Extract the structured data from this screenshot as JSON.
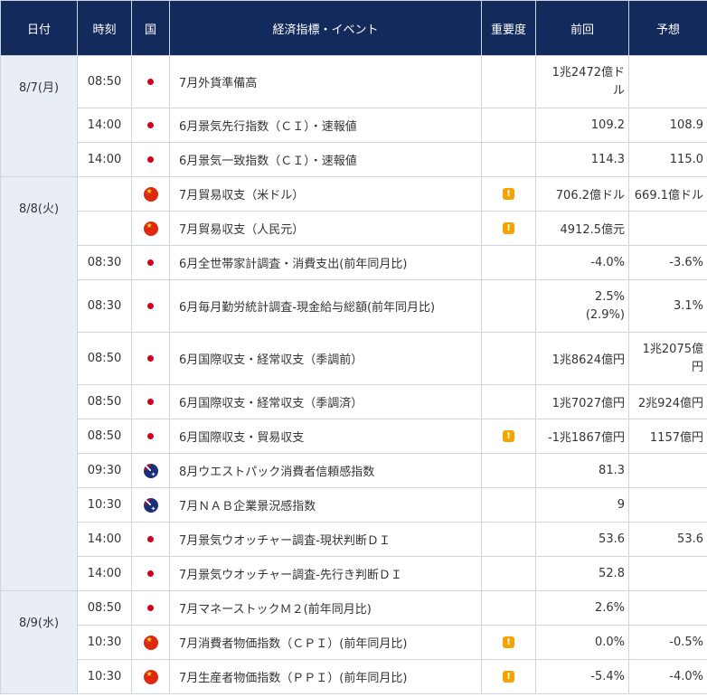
{
  "header": {
    "date": "日付",
    "time": "時刻",
    "country": "国",
    "indicator": "経済指標・イベント",
    "importance": "重要度",
    "previous": "前回",
    "forecast": "予想"
  },
  "colors": {
    "header_bg": "#132a5c",
    "date_bg": "#e9eef6",
    "importance": "#f5a300"
  },
  "icons": {
    "japan": "japan-flag-icon",
    "china": "china-flag-icon",
    "australia": "australia-flag-icon",
    "importance": "exclamation-icon"
  },
  "days": [
    {
      "date": "8/7(月)"
    },
    {
      "date": "8/8(火)"
    },
    {
      "date": "8/9(水)"
    }
  ],
  "rows": [
    {
      "time": "08:50",
      "country": "japan",
      "indicator": "7月外貨準備高",
      "important": false,
      "previous": [
        "1兆2472億ド",
        "ル"
      ],
      "forecast": [
        ""
      ]
    },
    {
      "time": "14:00",
      "country": "japan",
      "indicator": "6月景気先行指数（ＣＩ）・速報値",
      "important": false,
      "previous": [
        "109.2"
      ],
      "forecast": [
        "108.9"
      ]
    },
    {
      "time": "14:00",
      "country": "japan",
      "indicator": "6月景気一致指数（ＣＩ）・速報値",
      "important": false,
      "previous": [
        "114.3"
      ],
      "forecast": [
        "115.0"
      ]
    },
    {
      "time": "",
      "country": "china",
      "indicator": "7月貿易収支（米ドル）",
      "important": true,
      "previous": [
        "706.2億ドル"
      ],
      "forecast": [
        "669.1億ドル"
      ]
    },
    {
      "time": "",
      "country": "china",
      "indicator": "7月貿易収支（人民元）",
      "important": true,
      "previous": [
        "4912.5億元"
      ],
      "forecast": [
        ""
      ]
    },
    {
      "time": "08:30",
      "country": "japan",
      "indicator": "6月全世帯家計調査・消費支出(前年同月比)",
      "important": false,
      "previous": [
        "-4.0%"
      ],
      "forecast": [
        "-3.6%"
      ]
    },
    {
      "time": "08:30",
      "country": "japan",
      "indicator": "6月毎月勤労統計調査-現金給与総額(前年同月比)",
      "important": false,
      "previous": [
        "2.5%",
        "(2.9%)"
      ],
      "forecast": [
        "3.1%"
      ]
    },
    {
      "time": "08:50",
      "country": "japan",
      "indicator": "6月国際収支・経常収支（季調前）",
      "important": false,
      "previous": [
        "1兆8624億円"
      ],
      "forecast": [
        "1兆2075億",
        "円"
      ]
    },
    {
      "time": "08:50",
      "country": "japan",
      "indicator": "6月国際収支・経常収支（季調済）",
      "important": false,
      "previous": [
        "1兆7027億円"
      ],
      "forecast": [
        "2兆924億円"
      ]
    },
    {
      "time": "08:50",
      "country": "japan",
      "indicator": "6月国際収支・貿易収支",
      "important": true,
      "previous": [
        "-1兆1867億円"
      ],
      "forecast": [
        "1157億円"
      ]
    },
    {
      "time": "09:30",
      "country": "australia",
      "indicator": "8月ウエストパック消費者信頼感指数",
      "important": false,
      "previous": [
        "81.3"
      ],
      "forecast": [
        ""
      ]
    },
    {
      "time": "10:30",
      "country": "australia",
      "indicator": "7月ＮＡＢ企業景況感指数",
      "important": false,
      "previous": [
        "9"
      ],
      "forecast": [
        ""
      ]
    },
    {
      "time": "14:00",
      "country": "japan",
      "indicator": "7月景気ウオッチャー調査-現状判断ＤＩ",
      "important": false,
      "previous": [
        "53.6"
      ],
      "forecast": [
        "53.6"
      ]
    },
    {
      "time": "14:00",
      "country": "japan",
      "indicator": "7月景気ウオッチャー調査-先行き判断ＤＩ",
      "important": false,
      "previous": [
        "52.8"
      ],
      "forecast": [
        ""
      ]
    },
    {
      "time": "08:50",
      "country": "japan",
      "indicator": "7月マネーストックＭ２(前年同月比)",
      "important": false,
      "previous": [
        "2.6%"
      ],
      "forecast": [
        ""
      ]
    },
    {
      "time": "10:30",
      "country": "china",
      "indicator": "7月消費者物価指数（ＣＰＩ）(前年同月比)",
      "important": true,
      "previous": [
        "0.0%"
      ],
      "forecast": [
        "-0.5%"
      ]
    },
    {
      "time": "10:30",
      "country": "china",
      "indicator": "7月生産者物価指数（ＰＰＩ）(前年同月比)",
      "important": true,
      "previous": [
        "-5.4%"
      ],
      "forecast": [
        "-4.0%"
      ]
    }
  ]
}
